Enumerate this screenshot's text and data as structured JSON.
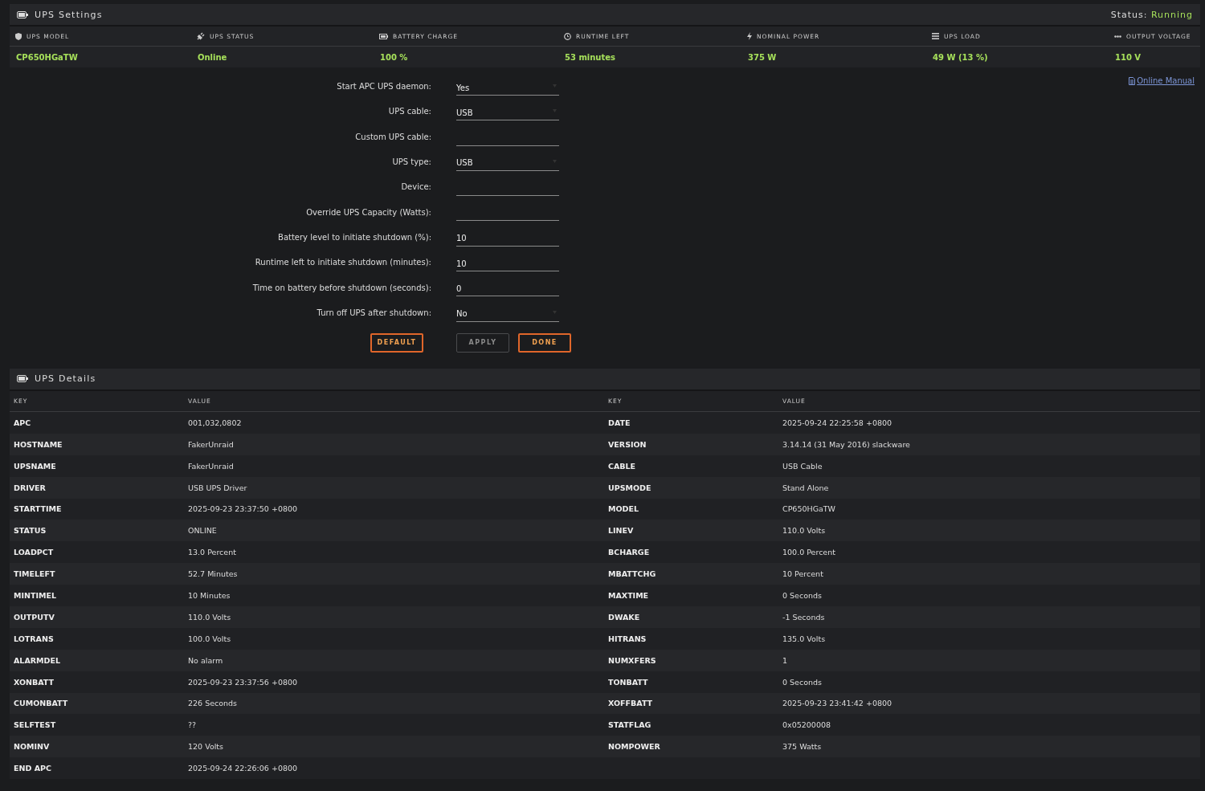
{
  "settings_panel": {
    "title": "UPS Settings",
    "status_label": "Status:",
    "status_value": "Running",
    "stats": [
      {
        "label": "UPS MODEL",
        "value": "CP650HGaTW"
      },
      {
        "label": "UPS STATUS",
        "value": "Online"
      },
      {
        "label": "BATTERY CHARGE",
        "value": "100 %"
      },
      {
        "label": "RUNTIME LEFT",
        "value": "53 minutes"
      },
      {
        "label": "NOMINAL POWER",
        "value": "375 W"
      },
      {
        "label": "UPS LOAD",
        "value": "49 W (13 %)"
      },
      {
        "label": "OUTPUT VOLTAGE",
        "value": "110 V"
      }
    ],
    "manual_link": "Online Manual",
    "form": [
      {
        "label": "Start APC UPS daemon:",
        "kind": "select",
        "value": "Yes"
      },
      {
        "label": "UPS cable:",
        "kind": "select",
        "value": "USB"
      },
      {
        "label": "Custom UPS cable:",
        "kind": "input"
      },
      {
        "label": "UPS type:",
        "kind": "select",
        "value": "USB"
      },
      {
        "label": "Device:",
        "kind": "input"
      },
      {
        "label": "Override UPS Capacity (Watts):",
        "kind": "input"
      },
      {
        "label": "Battery level to initiate shutdown (%):",
        "kind": "input",
        "value": "10"
      },
      {
        "label": "Runtime left to initiate shutdown (minutes):",
        "kind": "input",
        "value": "10"
      },
      {
        "label": "Time on battery before shutdown (seconds):",
        "kind": "input",
        "value": "0"
      },
      {
        "label": "Turn off UPS after shutdown:",
        "kind": "select",
        "value": "No"
      }
    ],
    "buttons": [
      {
        "label": "DEFAULT",
        "disabled": false
      },
      {
        "label": "APPLY",
        "disabled": true
      },
      {
        "label": "DONE",
        "disabled": false
      }
    ]
  },
  "details_panel": {
    "title": "UPS Details",
    "tables": [
      {
        "columns": [
          "KEY",
          "VALUE"
        ],
        "rows": [
          {
            "key": "APC",
            "value": "001,032,0802"
          },
          {
            "key": "HOSTNAME",
            "value": "FakerUnraid"
          },
          {
            "key": "UPSNAME",
            "value": "FakerUnraid"
          },
          {
            "key": "DRIVER",
            "value": "USB UPS Driver"
          },
          {
            "key": "STARTTIME",
            "value": "2025-09-23 23:37:50 +0800"
          },
          {
            "key": "STATUS",
            "value": "ONLINE"
          },
          {
            "key": "LOADPCT",
            "value": "13.0 Percent"
          },
          {
            "key": "TIMELEFT",
            "value": "52.7 Minutes"
          },
          {
            "key": "MINTIMEL",
            "value": "10 Minutes"
          },
          {
            "key": "OUTPUTV",
            "value": "110.0 Volts"
          },
          {
            "key": "LOTRANS",
            "value": "100.0 Volts"
          },
          {
            "key": "ALARMDEL",
            "value": "No alarm"
          },
          {
            "key": "XONBATT",
            "value": "2025-09-23 23:37:56 +0800"
          },
          {
            "key": "CUMONBATT",
            "value": "226 Seconds"
          },
          {
            "key": "SELFTEST",
            "value": "??"
          },
          {
            "key": "NOMINV",
            "value": "120 Volts"
          },
          {
            "key": "END APC",
            "value": "2025-09-24 22:26:06 +0800"
          }
        ]
      },
      {
        "columns": [
          "KEY",
          "VALUE"
        ],
        "rows": [
          {
            "key": "DATE",
            "value": "2025-09-24 22:25:58 +0800"
          },
          {
            "key": "VERSION",
            "value": "3.14.14 (31 May 2016) slackware"
          },
          {
            "key": "CABLE",
            "value": "USB Cable"
          },
          {
            "key": "UPSMODE",
            "value": "Stand Alone"
          },
          {
            "key": "MODEL",
            "value": "CP650HGaTW"
          },
          {
            "key": "LINEV",
            "value": "110.0 Volts"
          },
          {
            "key": "BCHARGE",
            "value": "100.0 Percent"
          },
          {
            "key": "MBATTCHG",
            "value": "10 Percent"
          },
          {
            "key": "MAXTIME",
            "value": "0 Seconds"
          },
          {
            "key": "DWAKE",
            "value": "-1 Seconds"
          },
          {
            "key": "HITRANS",
            "value": "135.0 Volts"
          },
          {
            "key": "NUMXFERS",
            "value": "1"
          },
          {
            "key": "TONBATT",
            "value": "0 Seconds"
          },
          {
            "key": "XOFFBATT",
            "value": "2025-09-23 23:41:42 +0800"
          },
          {
            "key": "STATFLAG",
            "value": "0x05200008"
          },
          {
            "key": "NOMPOWER",
            "value": "375 Watts"
          }
        ]
      }
    ]
  }
}
